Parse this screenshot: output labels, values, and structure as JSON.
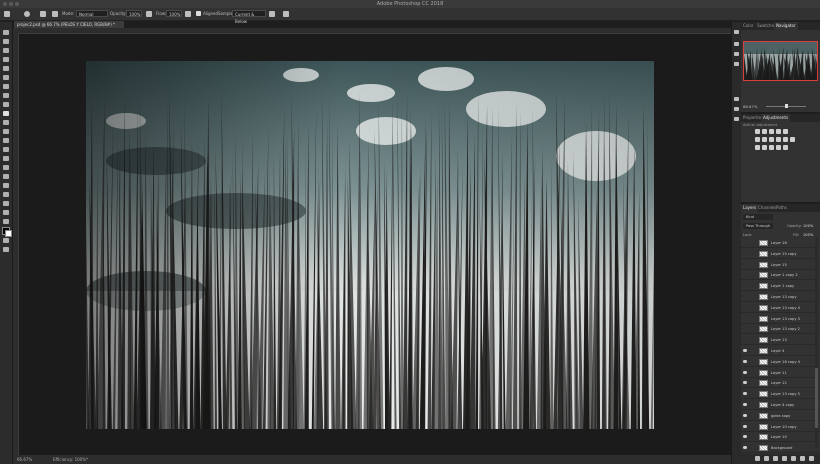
{
  "app": {
    "window_title": "Adobe Photoshop CC 2018"
  },
  "options_bar": {
    "mode_label": "Mode:",
    "mode_value": "Normal",
    "opacity_label": "Opacity:",
    "opacity_value": "100%",
    "flow_label": "Flow:",
    "flow_value": "100%",
    "aligned_label": "Aligned",
    "sample_label": "Sample:",
    "sample_value": "Current & Below"
  },
  "document": {
    "tab_title": "projec2.psd @ 66.7% (PELOS Y CIELO, RGB/8#) *",
    "status_zoom": "66.67%",
    "status_info": "Efficiency: 100%*"
  },
  "panels": {
    "top_tabs": [
      "Color",
      "Swatches",
      "Navigator"
    ],
    "active_top_tab": "Navigator",
    "navigator_zoom": "66.67%",
    "mid_tabs": [
      "Properties",
      "Adjustments"
    ],
    "active_mid_tab": "Adjustments",
    "adjustments_hint": "Add an adjustment",
    "layer_tabs": [
      "Layers",
      "Channels",
      "Paths"
    ],
    "active_layer_tab": "Layers",
    "filter_kind": "Kind",
    "blend_mode": "Pass Through",
    "opacity_label": "Opacity:",
    "opacity_value": "100%",
    "lock_label": "Lock:",
    "fill_label": "Fill:",
    "fill_value": "100%"
  },
  "layers": [
    {
      "name": "Layer 16",
      "visible": false
    },
    {
      "name": "Layer 15 copy",
      "visible": false
    },
    {
      "name": "Layer 15",
      "visible": false
    },
    {
      "name": "Layer 1 copy 2",
      "visible": false
    },
    {
      "name": "Layer 1 copy",
      "visible": false
    },
    {
      "name": "Layer 13 copy",
      "visible": false
    },
    {
      "name": "Layer 13 copy 4",
      "visible": false
    },
    {
      "name": "Layer 13 copy 3",
      "visible": false
    },
    {
      "name": "Layer 13 copy 2",
      "visible": false
    },
    {
      "name": "Layer 13",
      "visible": false
    },
    {
      "name": "Layer 4",
      "visible": true
    },
    {
      "name": "Layer 16 copy 4",
      "visible": true
    },
    {
      "name": "Layer 11",
      "visible": true
    },
    {
      "name": "Layer 12",
      "visible": true
    },
    {
      "name": "Layer 13 copy 5",
      "visible": true
    },
    {
      "name": "Layer 4 copy",
      "visible": true
    },
    {
      "name": "gotra copy",
      "visible": true
    },
    {
      "name": "Layer 10 copy",
      "visible": true
    },
    {
      "name": "Layer 10",
      "visible": true
    },
    {
      "name": "Background",
      "visible": true
    }
  ],
  "colors": {
    "accent": "#e03b3b",
    "panel": "#323232",
    "workspace": "#1b1b1b"
  }
}
